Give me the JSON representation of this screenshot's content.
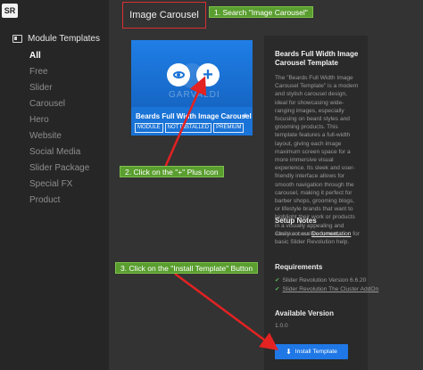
{
  "app": {
    "logo": "SR"
  },
  "sidebar": {
    "title": "Module Templates",
    "title_icon": "template-icon",
    "items": [
      {
        "label": "All",
        "active": true
      },
      {
        "label": "Free"
      },
      {
        "label": "Slider"
      },
      {
        "label": "Carousel"
      },
      {
        "label": "Hero"
      },
      {
        "label": "Website"
      },
      {
        "label": "Social Media"
      },
      {
        "label": "Slider Package"
      },
      {
        "label": "Special FX"
      },
      {
        "label": "Product"
      }
    ]
  },
  "search": {
    "value": "Image Carousel"
  },
  "steps": {
    "step1": "1. Search \"Image Carousel\"",
    "step2": "2. Click on the \"+\" Plus Icon",
    "step3": "3. Click on the \"Install Template\" Button"
  },
  "card": {
    "name": "Beards Full Width Image Carousel",
    "watermark": "GARVALDI",
    "badges": [
      "MODULE",
      "NOT INSTALLED",
      "PREMIUM"
    ],
    "plus_symbol": "+",
    "eye_icon": "eye-icon",
    "star": "★"
  },
  "detail": {
    "title": "Beards Full Width Image Carousel Template",
    "description": "The \"Beards Full Width Image Carousel Template\" is a modern and stylish carousel design, ideal for showcasing wide-ranging images, especially focusing on beard styles and grooming products. This template features a full-width layout, giving each image maximum screen space for a more immersive visual experience. Its sleek and user-friendly interface allows for smooth navigation through the carousel, making it perfect for barber shops, grooming blogs, or lifestyle brands that want to highlight their work or products in a visually appealing and easily accessible format.",
    "setup_title": "Setup Notes",
    "setup_pre": "Checkout our ",
    "setup_link": "Documentation",
    "setup_post": " for basic Slider Revolution help.",
    "requirements_title": "Requirements",
    "requirements": [
      {
        "text": "Slider Revolution Version 6.6.20",
        "link": false
      },
      {
        "text": "Slider Revolution The Cluster AddOn",
        "link": true
      }
    ],
    "check_glyph": "✔",
    "version_title": "Available Version",
    "version": "1.0.0",
    "install_label": "Install Template",
    "install_icon": "download-icon"
  },
  "colors": {
    "step_green": "#5a9e2f",
    "highlight_red": "#d93030",
    "arrow_red": "#e32222",
    "accent_blue": "#1f78e6"
  }
}
